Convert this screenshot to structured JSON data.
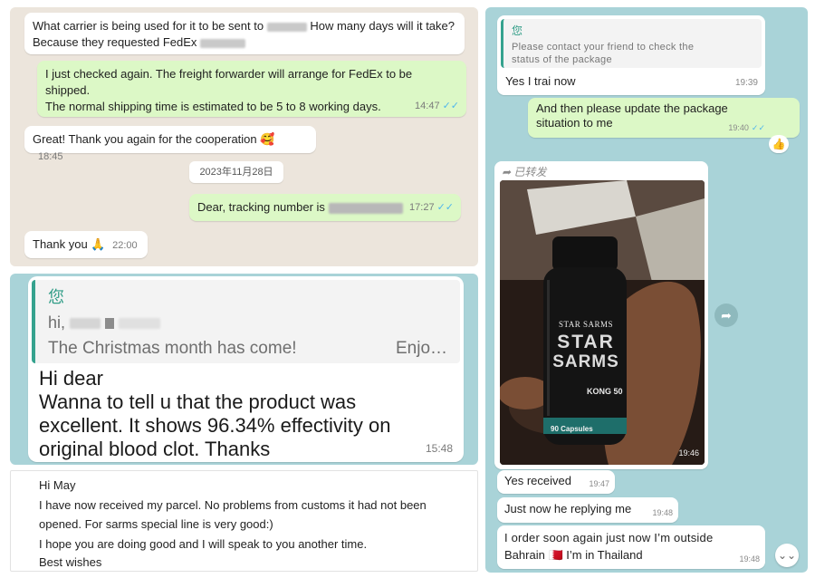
{
  "chat1": {
    "msg_in_1": {
      "line1": "What carrier is being used for it to be sent to",
      "line1b": "How many days will it take?",
      "line2": "Because they requested FedEx"
    },
    "msg_out_1": {
      "line1": "I just checked again. The freight forwarder will arrange for FedEx to be shipped.",
      "line2": "The normal shipping time is estimated to be 5 to 8 working days.",
      "time": "14:47"
    },
    "msg_in_2": {
      "text": "Great! Thank you again for the cooperation",
      "emoji": "🥰",
      "time": "18:45"
    },
    "date_chip": "2023年11月28日",
    "msg_out_2": {
      "text": "Dear, tracking number is",
      "time": "17:27"
    },
    "msg_in_3": {
      "text": "Thank you",
      "emoji": "🙏",
      "time": "22:00"
    }
  },
  "chat2": {
    "quote": {
      "sender": "您",
      "line1": "hi,",
      "line2": "The Christmas month has come!",
      "tail": "Enjo…"
    },
    "message": {
      "line1": "Hi dear",
      "line2": "Wanna to tell u that the product was",
      "line3": "excellent. It shows 96.34% effectivity on",
      "line4": "original blood clot. Thanks",
      "time": "15:48"
    }
  },
  "chat3": {
    "lines": [
      "Hi May",
      "I have now received my parcel. No problems from customs it had not been",
      "opened. For sarms special line is very good:)",
      "I hope you are doing good and I will speak to you another time.",
      "Best wishes"
    ]
  },
  "chat4": {
    "msg_quote": {
      "sender": "您",
      "line1": "Please contact your friend to check the",
      "line2": "status of the package",
      "reply": "Yes I trai now",
      "time": "19:39"
    },
    "msg_out": {
      "line1": "And then please update the package",
      "line2": "situation to me",
      "time": "19:40",
      "reaction": "👍"
    },
    "forwarded": {
      "label": "已转发",
      "time": "19:46"
    },
    "product": {
      "brand_small": "STAR SARMS",
      "brand_big1": "STAR",
      "brand_big2": "SARMS",
      "variant": "KONG 50",
      "count": "90 Capsules"
    },
    "msg_yes": {
      "text": "Yes received",
      "time": "19:47"
    },
    "msg_now": {
      "text": "Just now he replying me",
      "time": "19:48"
    },
    "msg_order": {
      "line1": "I order soon again just now I’m outside",
      "line2a": "Bahrain",
      "flag": "🇧🇭",
      "line2b": "I’m in Thailand",
      "time": "19:48"
    }
  },
  "colors": {
    "beige_bg": "#ece5dc",
    "teal_bg": "#a9d3d8",
    "outgoing": "#dcf8c6",
    "quote_bar": "#35a28e",
    "ticks": "#4fb6ec"
  }
}
